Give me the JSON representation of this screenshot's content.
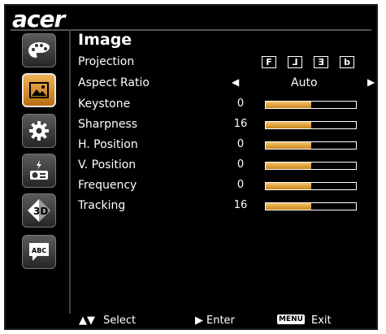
{
  "brand": "acer",
  "menu": {
    "title": "Image",
    "projection": {
      "label": "Projection",
      "options": [
        "F",
        "⅃",
        "Ǝ",
        "b"
      ]
    },
    "aspect_ratio": {
      "label": "Aspect Ratio",
      "value": "Auto"
    },
    "sliders": [
      {
        "label": "Keystone",
        "value": "0",
        "level": 0.5
      },
      {
        "label": "Sharpness",
        "value": "16",
        "level": 0.5
      },
      {
        "label": "H. Position",
        "value": "0",
        "level": 0.5
      },
      {
        "label": "V. Position",
        "value": "0",
        "level": 0.5
      },
      {
        "label": "Frequency",
        "value": "0",
        "level": 0.5
      },
      {
        "label": "Tracking",
        "value": "16",
        "level": 0.5
      }
    ]
  },
  "sidebar": {
    "items": [
      {
        "icon": "palette-icon",
        "active": false
      },
      {
        "icon": "image-icon",
        "active": true
      },
      {
        "icon": "gear-icon",
        "active": false
      },
      {
        "icon": "power-projector-icon",
        "active": false
      },
      {
        "icon": "3d-icon",
        "active": false
      },
      {
        "icon": "language-icon",
        "label": "ABC",
        "active": false
      }
    ]
  },
  "footer": {
    "select": "Select",
    "enter": "Enter",
    "menu_key": "MENU",
    "exit": "Exit"
  },
  "colors": {
    "accent": "#e39a3a",
    "background": "#000000"
  }
}
